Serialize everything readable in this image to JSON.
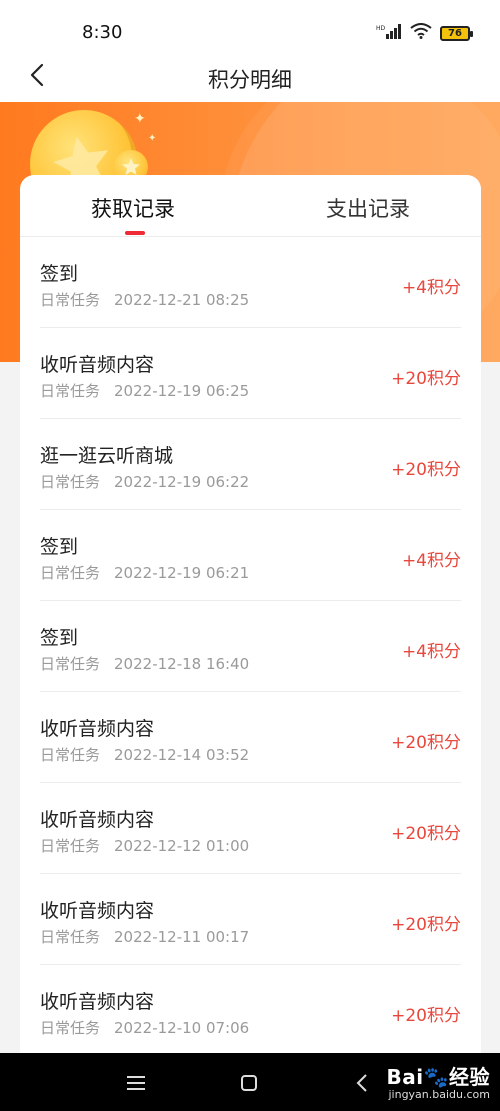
{
  "status_bar": {
    "time": "8:30",
    "battery": "76",
    "icons": [
      "hd-signal-icon",
      "wifi-icon",
      "battery-icon"
    ]
  },
  "header": {
    "title": "积分明细",
    "back_icon": "chevron-left-icon"
  },
  "banner": {
    "colors": {
      "start": "#ff7a1f",
      "end": "#ffa04e"
    },
    "decoration": "coin-icon"
  },
  "tabs": [
    {
      "label": "获取记录",
      "active": true
    },
    {
      "label": "支出记录",
      "active": false
    }
  ],
  "accent_color": "#ee2b36",
  "points_color": "#e8473c",
  "records": [
    {
      "title": "签到",
      "category": "日常任务",
      "datetime": "2022-12-21 08:25",
      "points": "+4积分"
    },
    {
      "title": "收听音频内容",
      "category": "日常任务",
      "datetime": "2022-12-19 06:25",
      "points": "+20积分"
    },
    {
      "title": "逛一逛云听商城",
      "category": "日常任务",
      "datetime": "2022-12-19 06:22",
      "points": "+20积分"
    },
    {
      "title": "签到",
      "category": "日常任务",
      "datetime": "2022-12-19 06:21",
      "points": "+4积分"
    },
    {
      "title": "签到",
      "category": "日常任务",
      "datetime": "2022-12-18 16:40",
      "points": "+4积分"
    },
    {
      "title": "收听音频内容",
      "category": "日常任务",
      "datetime": "2022-12-14 03:52",
      "points": "+20积分"
    },
    {
      "title": "收听音频内容",
      "category": "日常任务",
      "datetime": "2022-12-12 01:00",
      "points": "+20积分"
    },
    {
      "title": "收听音频内容",
      "category": "日常任务",
      "datetime": "2022-12-11 00:17",
      "points": "+20积分"
    },
    {
      "title": "收听音频内容",
      "category": "日常任务",
      "datetime": "2022-12-10 07:06",
      "points": "+20积分"
    }
  ],
  "system_nav": {
    "buttons": [
      "menu-icon",
      "home-icon",
      "back-icon"
    ]
  },
  "watermark": {
    "logo": "Bai🐾经验",
    "url": "jingyan.baidu.com"
  }
}
